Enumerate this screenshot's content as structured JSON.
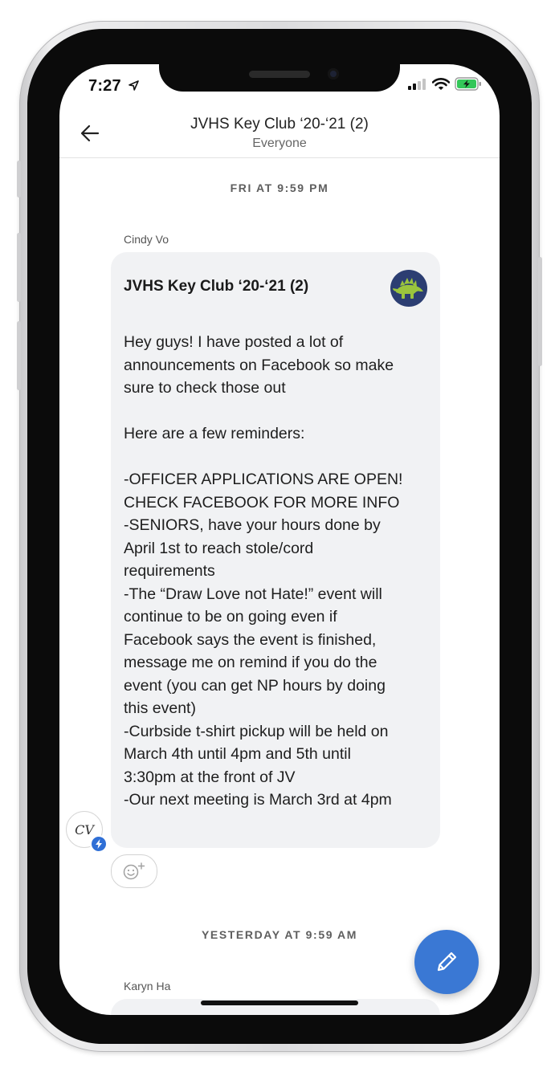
{
  "status_bar": {
    "time": "7:27"
  },
  "header": {
    "title": "JVHS Key Club ‘20-‘21 (2)",
    "subtitle": "Everyone"
  },
  "feed": {
    "day_label_1": "FRI AT 9:59 PM",
    "sender_1": "Cindy Vo",
    "sender_1_initials": "CV",
    "message_1": {
      "class_title": "JVHS Key Club ‘20-‘21 (2)",
      "lines": [
        "Hey guys! I have posted a lot of",
        "announcements on Facebook so make",
        "sure to check those out",
        "",
        "Here are a few reminders:",
        "",
        "-OFFICER APPLICATIONS ARE OPEN!",
        "CHECK FACEBOOK FOR MORE INFO",
        "-SENIORS, have your hours done by",
        "April 1st to reach stole/cord",
        "requirements",
        "-The “Draw Love not Hate!” event will",
        "continue to be on going even if",
        "Facebook says the event is finished,",
        "message me on remind if you do the",
        "event (you can get NP hours by doing",
        "this event)",
        "-Curbside t-shirt pickup will be held on",
        "March 4th until 4pm and 5th until",
        "3:30pm at the front of JV",
        "-Our next meeting is March 3rd at 4pm"
      ]
    },
    "day_label_2": "YESTERDAY AT 9:59 AM",
    "sender_2": "Karyn Ha"
  },
  "icons": {
    "back": "arrow-left-icon",
    "react": "add-reaction-icon",
    "compose": "pencil-icon",
    "badge": "lightning-bolt-icon",
    "class_avatar": "stegosaurus-icon"
  },
  "colors": {
    "accent": "#3a78d4",
    "bubble": "#f1f2f4",
    "class_avatar_bg": "#2c3e72",
    "battery": "#34c759"
  }
}
